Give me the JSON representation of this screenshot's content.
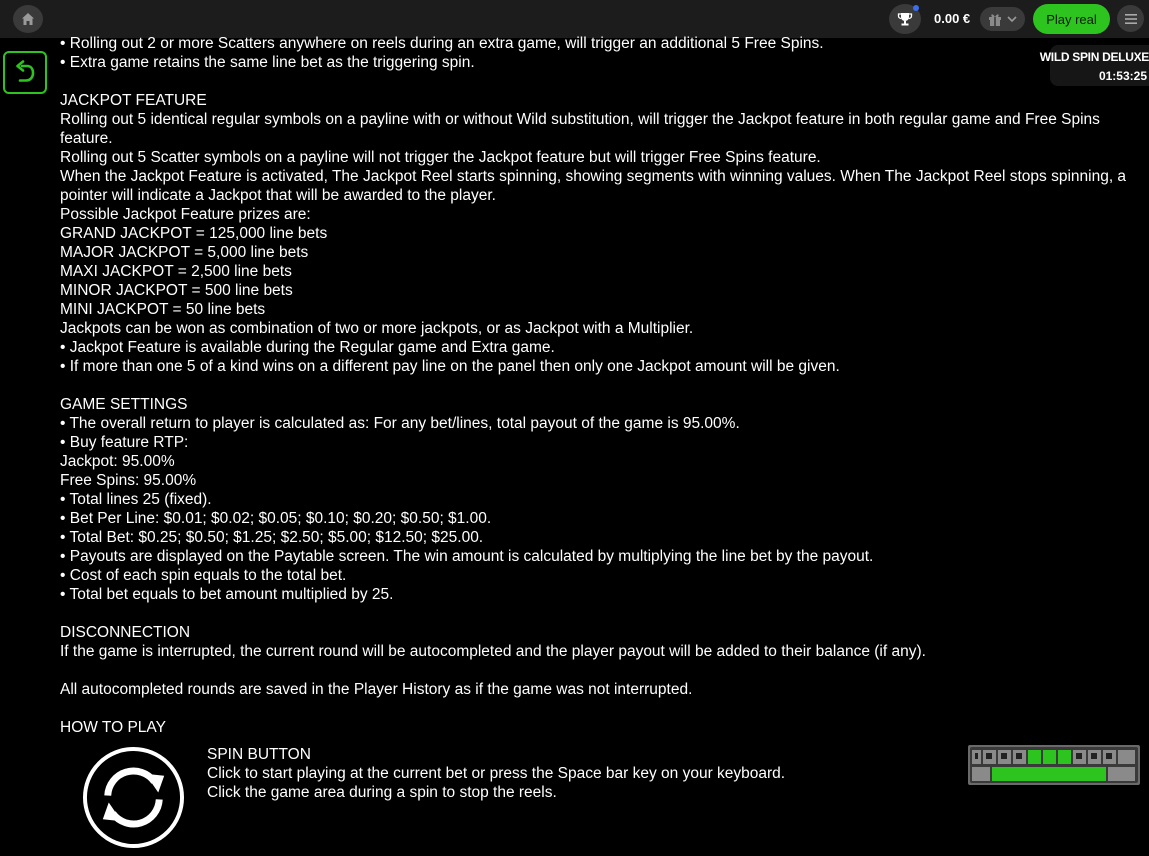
{
  "topbar": {
    "balance": "0.00 €",
    "play_real_label": "Play real"
  },
  "game": {
    "name": "WILD SPIN DELUXE",
    "time": "01:53:25"
  },
  "rules": {
    "cut_line": "• Rolling out 2 or more Scatters anywhere on reels during an extra game, will trigger an additional 5 Free Spins.",
    "extra_game_line": "• Extra game retains the same line bet as the triggering spin.",
    "jackpot": {
      "heading": "JACKPOT FEATURE",
      "lines": [
        "Rolling out 5 identical regular symbols on a payline with or without Wild substitution, will trigger the Jackpot feature in both regular game and Free Spins",
        "feature.",
        "Rolling out 5 Scatter symbols on a payline will not trigger the Jackpot feature but will trigger Free Spins feature.",
        "When the Jackpot Feature is activated, The Jackpot Reel starts spinning, showing segments with winning values. When The Jackpot Reel stops spinning, a",
        "pointer will indicate a Jackpot that will be awarded to the player.",
        "Possible Jackpot Feature prizes are:",
        "GRAND JACKPOT = 125,000 line bets",
        "MAJOR JACKPOT = 5,000 line bets",
        "MAXI JACKPOT = 2,500 line bets",
        "MINOR JACKPOT = 500 line bets",
        "MINI JACKPOT = 50 line bets",
        "Jackpots can be won as combination of two or more jackpots, or as Jackpot with a Multiplier.",
        "• Jackpot Feature is available during the Regular game and Extra game.",
        "• If more than one 5 of a kind wins on a different pay line on the panel then only one Jackpot amount will be given."
      ]
    },
    "settings": {
      "heading": "GAME SETTINGS",
      "lines": [
        "• The overall return to player is calculated as: For any bet/lines, total payout of the game is 95.00%.",
        "• Buy feature RTP:",
        "Jackpot: 95.00%",
        "Free Spins: 95.00%",
        "• Total lines 25 (fixed).",
        "• Bet Per Line:  $0.01; $0.02; $0.05; $0.10; $0.20; $0.50; $1.00.",
        "• Total Bet:  $0.25; $0.50; $1.25; $2.50; $5.00; $12.50; $25.00.",
        "• Payouts are displayed on the Paytable screen. The win amount is calculated by multiplying the line bet by the payout.",
        "• Cost of each spin equals to the total bet.",
        "• Total bet equals to bet amount multiplied by 25."
      ]
    },
    "disconnection": {
      "heading": "DISCONNECTION",
      "lines": [
        "If the game is interrupted, the current round will be autocompleted and the player payout will be added to their balance (if any).",
        "All autocompleted rounds are saved in the Player History as if the game was not interrupted."
      ]
    },
    "how_to_play": {
      "heading": "HOW TO PLAY",
      "spin_title": "SPIN BUTTON",
      "spin_lines": [
        "Click to start playing at the current bet or press the Space bar key on your keyboard.",
        "Click the game area during a spin to stop the reels."
      ]
    }
  },
  "icons": {
    "home": "home-icon",
    "trophy": "trophy-icon",
    "gift": "gift-icon",
    "chevron": "chevron-down-icon",
    "menu": "hamburger-menu-icon",
    "back": "back-arrow-icon",
    "spin": "spin-refresh-icon",
    "keyboard": "keyboard-icon"
  },
  "colors": {
    "accent": "#2ec41f",
    "topbar": "#1c1c1c",
    "background": "#000000"
  }
}
